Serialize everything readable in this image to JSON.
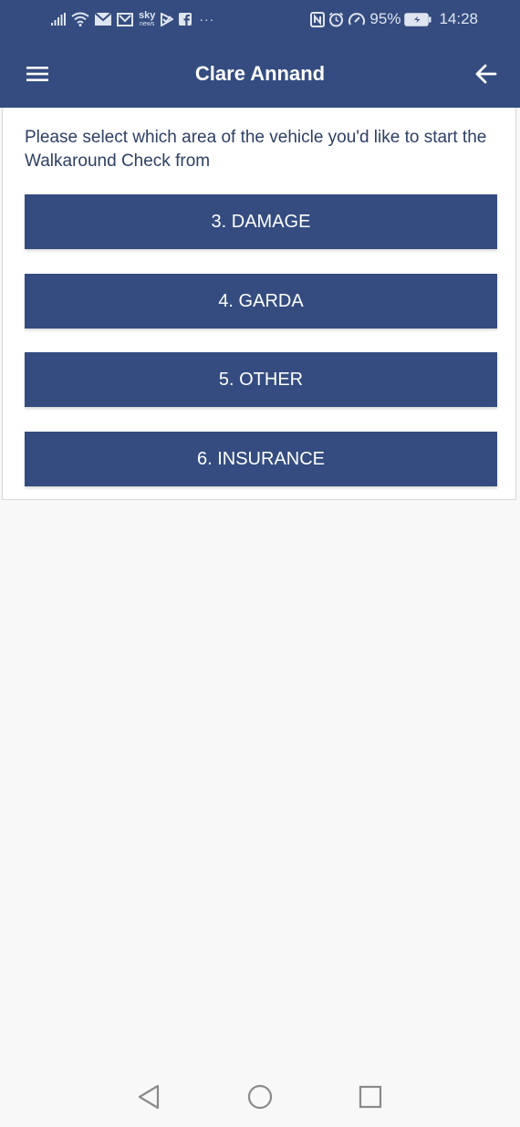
{
  "status_bar": {
    "carrier_icon": "sky-news-icon",
    "carrier_top": "sky",
    "carrier_bottom": "news",
    "more": "···",
    "battery": "95%",
    "time": "14:28"
  },
  "header": {
    "title": "Clare Annand",
    "menu_icon": "hamburger-menu-icon",
    "back_icon": "arrow-left-icon"
  },
  "content": {
    "prompt": "Please select which area of the vehicle you'd like to start the Walkaround Check from",
    "options": [
      {
        "label": "3. DAMAGE"
      },
      {
        "label": "4. GARDA"
      },
      {
        "label": "5. OTHER"
      },
      {
        "label": "6. INSURANCE"
      }
    ]
  },
  "nav_bar": {
    "back_icon": "triangle-back-icon",
    "home_icon": "circle-home-icon",
    "recents_icon": "square-recents-icon"
  },
  "colors": {
    "primary": "#344c80",
    "text": "#2d3f64",
    "background": "#f8f8f8"
  }
}
